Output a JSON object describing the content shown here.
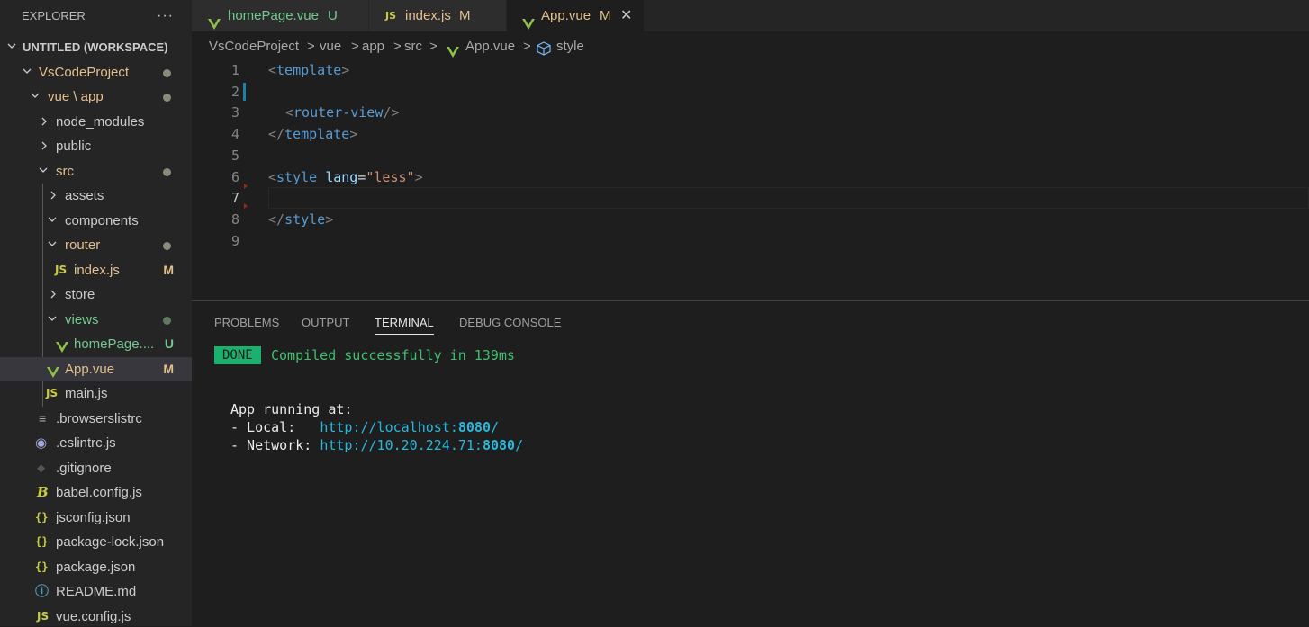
{
  "explorer": {
    "title": "EXPLORER",
    "more": "···",
    "tree": [
      {
        "label": "UNTITLED (WORKSPACE)"
      },
      {
        "label": "VsCodeProject",
        "status": "dot"
      },
      {
        "label": "vue \\ app",
        "status": "dot"
      },
      {
        "label": "node_modules"
      },
      {
        "label": "public"
      },
      {
        "label": "src",
        "status": "dot"
      },
      {
        "label": "assets"
      },
      {
        "label": "components"
      },
      {
        "label": "router",
        "status": "dot"
      },
      {
        "label": "index.js",
        "icon": "JS",
        "status": "M"
      },
      {
        "label": "store"
      },
      {
        "label": "views",
        "status": "dot"
      },
      {
        "label": "homePage....",
        "icon": "V",
        "status": "U"
      },
      {
        "label": "App.vue",
        "icon": "V",
        "status": "M"
      },
      {
        "label": "main.js",
        "icon": "JS"
      },
      {
        "label": ".browserslistrc",
        "icon": "≡"
      },
      {
        "label": ".eslintrc.js",
        "icon": "◉"
      },
      {
        "label": ".gitignore",
        "icon": "◆"
      },
      {
        "label": "babel.config.js",
        "icon": "B"
      },
      {
        "label": "jsconfig.json",
        "icon": "{}"
      },
      {
        "label": "package-lock.json",
        "icon": "{}"
      },
      {
        "label": "package.json",
        "icon": "{}"
      },
      {
        "label": "README.md",
        "icon": "ⓘ"
      },
      {
        "label": "vue.config.js",
        "icon": "JS"
      }
    ]
  },
  "tabs": [
    {
      "label": "homePage.vue",
      "status": "U",
      "icon": "V"
    },
    {
      "label": "index.js",
      "status": "M",
      "icon": "JS"
    },
    {
      "label": "App.vue",
      "status": "M",
      "icon": "V",
      "close": "✕"
    }
  ],
  "breadcrumb": [
    "VsCodeProject",
    "vue",
    "app",
    "src",
    "App.vue",
    "style"
  ],
  "breadcrumb_sep": ">",
  "editor": {
    "line_numbers": [
      "1",
      "2",
      "3",
      "4",
      "5",
      "6",
      "7",
      "8",
      "9"
    ],
    "code": {
      "l1_open": "<",
      "l1_tag": "template",
      "l1_close": ">",
      "l3_open": "<",
      "l3_tag": "router-view",
      "l3_close": "/>",
      "l4_open": "</",
      "l4_tag": "template",
      "l4_close": ">",
      "l6_open": "<",
      "l6_tag": "style",
      "l6_attr": "lang",
      "l6_eq": "=",
      "l6_str": "\"less\"",
      "l6_close": ">",
      "l8_open": "</",
      "l8_tag": "style",
      "l8_close": ">"
    }
  },
  "panel": {
    "tabs": [
      "PROBLEMS",
      "OUTPUT",
      "TERMINAL",
      "DEBUG CONSOLE"
    ],
    "active_tab": "TERMINAL",
    "terminal": {
      "badge": "DONE",
      "compiled": "Compiled successfully in 139ms",
      "running": "App running at:",
      "local_label": "- Local:   ",
      "local_url_pre": "http://localhost:",
      "local_port": "8080",
      "local_url_post": "/",
      "network_label": "- Network: ",
      "network_url_pre": "http://10.20.224.71:",
      "network_port": "8080",
      "network_url_post": "/"
    }
  },
  "colors": {
    "accent_modified": "#e2c08d",
    "accent_untracked": "#73c991",
    "vue_green": "#8dc149",
    "js_yellow": "#cbcb41",
    "terminal_green": "#23d18b",
    "terminal_link": "#29b8db"
  }
}
